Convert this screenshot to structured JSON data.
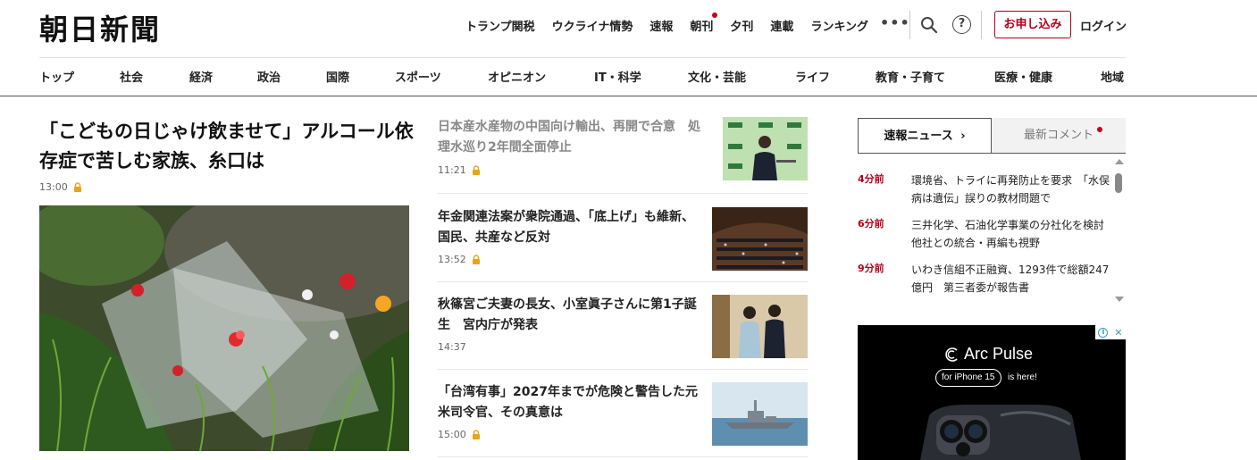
{
  "header": {
    "logo": "朝日新聞",
    "top_links": [
      {
        "label": "トランプ関税",
        "dot": false
      },
      {
        "label": "ウクライナ情勢",
        "dot": false
      },
      {
        "label": "速報",
        "dot": false
      },
      {
        "label": "朝刊",
        "dot": true
      },
      {
        "label": "夕刊",
        "dot": false
      },
      {
        "label": "連載",
        "dot": false
      },
      {
        "label": "ランキング",
        "dot": false
      }
    ],
    "more_label": "•••",
    "help_label": "?",
    "subscribe_label": "お申し込み",
    "login_label": "ログイン"
  },
  "categories": [
    "トップ",
    "社会",
    "経済",
    "政治",
    "国際",
    "スポーツ",
    "オピニオン",
    "IT・科学",
    "文化・芸能",
    "ライフ",
    "教育・子育て",
    "医療・健康",
    "地域"
  ],
  "lead": {
    "title": "「こどもの日じゃけ飲ませて」アルコール依存症で苦しむ家族、糸口は",
    "time": "13:00"
  },
  "articles": [
    {
      "title": "日本産水産物の中国向け輸出、再開で合意　処理水巡り2年間全面停止",
      "time": "11:21",
      "faded": true
    },
    {
      "title": "年金関連法案が衆院通過、「底上げ」も維新、国民、共産など反対",
      "time": "13:52",
      "faded": false
    },
    {
      "title": "秋篠宮ご夫妻の長女、小室眞子さんに第1子誕生　宮内庁が発表",
      "time": "14:37",
      "faded": false
    },
    {
      "title": "「台湾有事」2027年までが危険と警告した元米司令官、その真意は",
      "time": "15:00",
      "faded": false
    }
  ],
  "sidebar": {
    "tab_breaking": "速報ニュース",
    "tab_comments": "最新コメント",
    "news": [
      {
        "ago": "4分前",
        "text": "環境省、トライに再発防止を要求　「水俣病は遺伝」誤りの教材問題で"
      },
      {
        "ago": "6分前",
        "text": "三井化学、石油化学事業の分社化を検討　他社との統合・再編も視野"
      },
      {
        "ago": "9分前",
        "text": "いわき信組不正融資、1293件で総額247億円　第三者委が報告書"
      }
    ]
  },
  "ad": {
    "brand": "Arc Pulse",
    "pill": "for iPhone 15",
    "sub": "is here!"
  },
  "colors": {
    "accent": "#b3001b",
    "text": "#222222",
    "divider": "#e5e5e5"
  }
}
